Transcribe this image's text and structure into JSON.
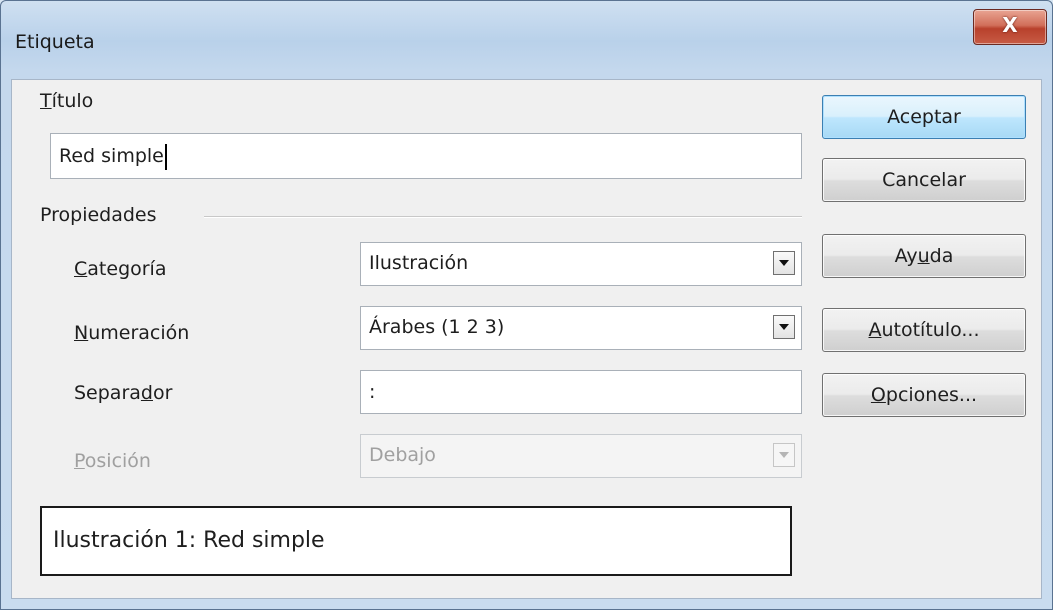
{
  "window": {
    "title": "Etiqueta",
    "close_label": "X"
  },
  "titulo": {
    "label": "Título",
    "value": "Red simple"
  },
  "propiedades": {
    "group_label": "Propiedades",
    "categoria": {
      "label": "Categoría",
      "value": "Ilustración"
    },
    "numeracion": {
      "label": "Numeración",
      "value": "Árabes (1 2 3)"
    },
    "separador": {
      "label": "Separador",
      "value": ":"
    },
    "posicion": {
      "label": "Posición",
      "value": "Debajo",
      "disabled": true
    }
  },
  "preview": {
    "text": "Ilustración 1: Red simple"
  },
  "buttons": {
    "aceptar": "Aceptar",
    "cancelar": "Cancelar",
    "ayuda": "Ayuda",
    "autotitulo": "Autotítulo...",
    "opciones": "Opciones..."
  },
  "colors": {
    "titlebar": "#c4d8ed",
    "close_button": "#c75b45",
    "dialog_background": "#f0f0f0",
    "default_button": "#bee6fd"
  }
}
